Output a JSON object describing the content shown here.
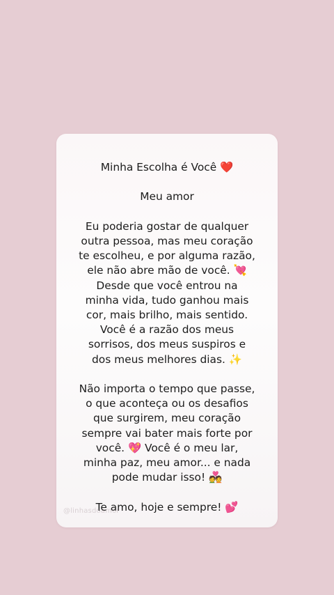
{
  "post": {
    "title": "Minha Escolha é Você ❤️",
    "greeting": "Meu amor",
    "paragraph1": [
      "Eu poderia gostar de qualquer",
      "outra pessoa, mas meu coração",
      "te escolheu, e por alguma razão,",
      "ele não abre mão de você. 💘",
      "Desde que você entrou na",
      "minha vida, tudo ganhou mais",
      "cor, mais brilho, mais sentido.",
      "Você é a razão dos meus",
      "sorrisos, dos meus suspiros e",
      "dos meus melhores dias. ✨"
    ],
    "paragraph2": [
      "Não importa o tempo que passe,",
      "o que aconteça ou os desafios",
      "que surgirem, meu coração",
      "sempre vai bater mais forte por",
      "você. 💖 Você é o meu lar,",
      "minha paz, meu amor... e nada",
      "pode mudar isso! 💑"
    ],
    "closing": "Te amo, hoje e sempre! 💕",
    "watermark": "@linhasdoamor"
  },
  "colors": {
    "background": "#e6cdd3",
    "card": "#fcf9fa",
    "text": "#1c1c1c"
  }
}
